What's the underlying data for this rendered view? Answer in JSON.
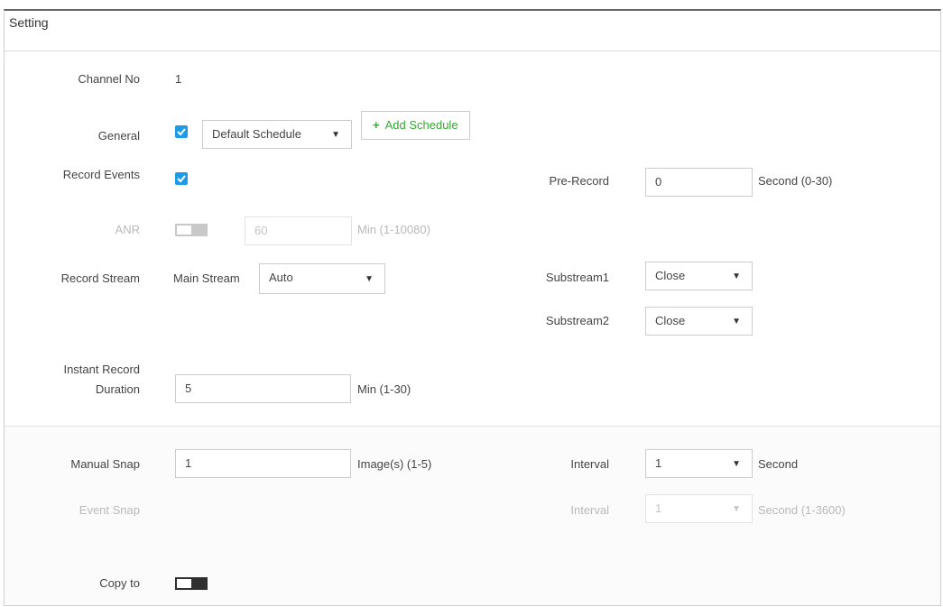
{
  "window": {
    "title": "Setting"
  },
  "colors": {
    "accent": "#1e9be6",
    "add_green": "#3aa53a",
    "disabled_text": "#b9b9b9"
  },
  "channel": {
    "label": "Channel No",
    "value": "1"
  },
  "general": {
    "label": "General",
    "checked": true,
    "schedule_value": "Default Schedule",
    "add_schedule_label": "Add Schedule"
  },
  "record_events": {
    "label": "Record Events",
    "checked": true
  },
  "pre_record": {
    "label": "Pre-Record",
    "value": "0",
    "unit": "Second (0-30)"
  },
  "anr": {
    "label": "ANR",
    "enabled": false,
    "value": "60",
    "unit": "Min (1-10080)"
  },
  "record_stream": {
    "label": "Record Stream",
    "main_label": "Main Stream",
    "main_value": "Auto",
    "sub1_label": "Substream1",
    "sub1_value": "Close",
    "sub2_label": "Substream2",
    "sub2_value": "Close"
  },
  "instant_record": {
    "label_line1": "Instant Record",
    "label_line2": "Duration",
    "value": "5",
    "unit": "Min (1-30)"
  },
  "manual_snap": {
    "label": "Manual Snap",
    "value": "1",
    "unit": "Image(s) (1-5)",
    "interval_label": "Interval",
    "interval_value": "1",
    "interval_unit": "Second"
  },
  "event_snap": {
    "label": "Event Snap",
    "interval_label": "Interval",
    "interval_value": "1",
    "interval_unit": "Second (1-3600)"
  },
  "copy_to": {
    "label": "Copy to",
    "enabled": false
  }
}
